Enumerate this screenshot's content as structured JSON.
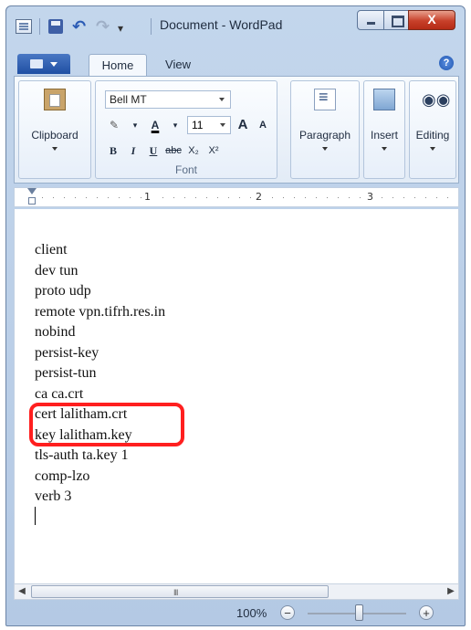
{
  "window": {
    "title": "Document - WordPad",
    "close_glyph": "X"
  },
  "tabs": [
    {
      "label": "Home"
    },
    {
      "label": "View"
    }
  ],
  "ribbon": {
    "clipboard_label": "Clipboard",
    "font_name": "Bell MT",
    "font_size": "11",
    "grow_label": "A",
    "shrink_label": "A",
    "color_label": "A",
    "bold_label": "B",
    "italic_label": "I",
    "underline_label": "U",
    "strike_label": "abc",
    "subscript_label": "X₂",
    "superscript_label": "X²",
    "font_group_label": "Font",
    "paragraph_label": "Paragraph",
    "insert_label": "Insert",
    "editing_label": "Editing"
  },
  "ruler": {
    "marks": [
      "1",
      "2",
      "3"
    ]
  },
  "document": {
    "lines": [
      "client",
      "dev tun",
      "proto udp",
      "remote vpn.tifrh.res.in",
      "nobind",
      "persist-key",
      "persist-tun",
      "ca ca.crt",
      "cert lalitham.crt",
      "key lalitham.key",
      "tls-auth ta.key 1",
      "comp-lzo",
      "verb 3"
    ]
  },
  "statusbar": {
    "zoom": "100%",
    "zoom_out": "−",
    "zoom_in": "+"
  },
  "scrollbar": {
    "grip": "III"
  },
  "colors": {
    "highlight_border": "#ff1f1f",
    "file_button": "#2a5bb5"
  }
}
